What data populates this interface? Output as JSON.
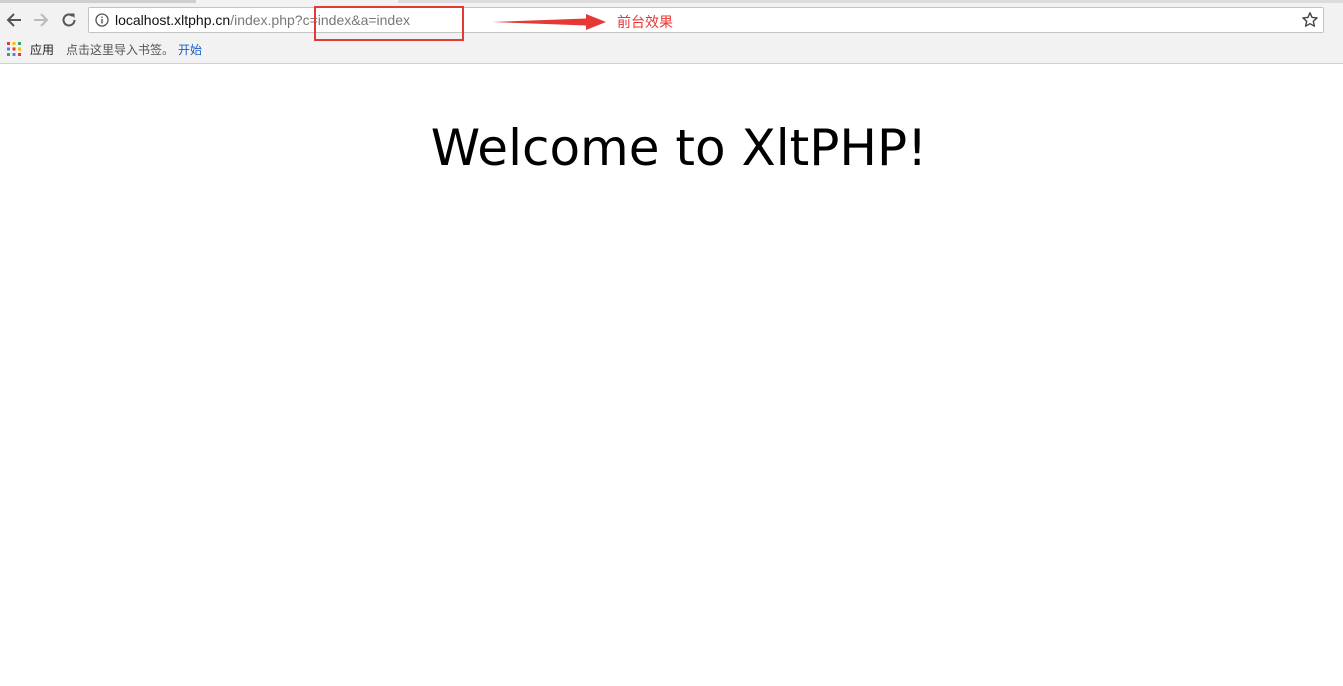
{
  "browser": {
    "url_host": "localhost.xltphp.cn",
    "url_rest": "/index.php?c=index&a=index",
    "bookmarks_bar": {
      "apps_label": "应用",
      "hint_text": "点击这里导入书签。",
      "link_label": "开始"
    }
  },
  "annotation": {
    "label": "前台效果",
    "color": "#e53935"
  },
  "page": {
    "heading": "Welcome to XltPHP!"
  },
  "icons": {
    "back": "back-arrow-icon",
    "forward": "forward-arrow-icon",
    "reload": "reload-icon",
    "info": "info-icon",
    "bookmark": "star-icon",
    "apps": "apps-grid-icon"
  }
}
